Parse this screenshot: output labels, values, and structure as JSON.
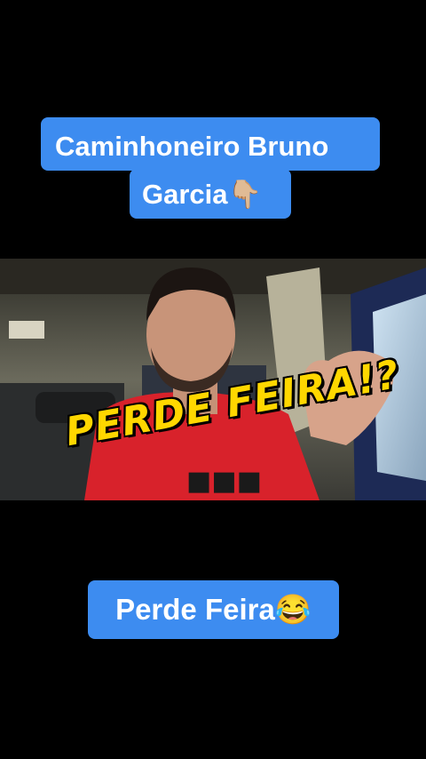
{
  "caption_top": {
    "line1": "Caminhoneiro Bruno",
    "line2": "Garcia",
    "emoji": "👇🏼"
  },
  "overlay": {
    "text": "PERDE FEIRA!?"
  },
  "caption_bottom": {
    "text": "Perde Feira",
    "emoji": "😂"
  },
  "colors": {
    "caption_bg": "#3d8cf0",
    "overlay_text": "#ffd700",
    "shirt": "#d8222b"
  }
}
